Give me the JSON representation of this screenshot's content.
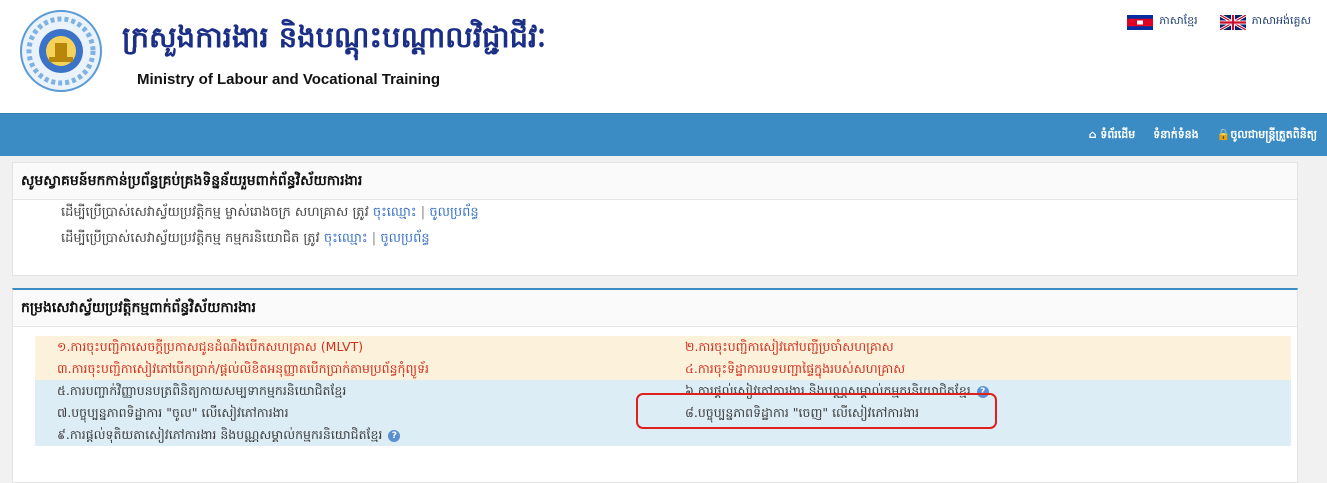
{
  "header": {
    "title_km": "ក្រសួងការងារ និងបណ្តុះបណ្តាលវិជ្ជាជីវៈ",
    "title_en": "Ministry of Labour and Vocational Training",
    "languages": [
      {
        "label": "ភាសាខ្មែរ",
        "icon": "cambodia-flag-icon"
      },
      {
        "label": "ភាសាអង់គ្លេស",
        "icon": "uk-flag-icon"
      }
    ]
  },
  "nav": {
    "home": "ទំព័រដើម",
    "contact": "ទំនាក់ទំនង",
    "login": "ចូលជាមន្រ្តីត្រួតពិនិត្យ",
    "home_icon": "home-icon",
    "lock_icon": "lock-icon"
  },
  "welcome": {
    "heading": "សូមស្វាគមន៍មកកាន់ប្រព័ន្ធគ្រប់គ្រងទិន្នន័យរួមពាក់ព័ន្ធវិស័យការងារ",
    "line1_text": "ដើម្បីប្រើប្រាស់សេវាស្វ័យប្រវត្តិកម្ម ម្ចាស់រោងចក្រ សហគ្រាស ត្រូវ",
    "line2_text": "ដើម្បីប្រើប្រាស់សេវាស្វ័យប្រវត្តិកម្ម កម្មករនិយោជិត ត្រូវ",
    "register": "ចុះឈ្មោះ",
    "separator": "|",
    "login": "ចូលប្រព័ន្ធ"
  },
  "services": {
    "heading": "កម្រងសេវាស្វ័យប្រវត្តិកម្មពាក់ព័ន្ធវិស័យការងារ",
    "items": [
      "១.ការចុះបញ្ជិកាសេចក្តីប្រកាសជូនដំណឹងបើកសហគ្រាស (MLVT)",
      "២.ការចុះបញ្ជិកាសៀវភៅបញ្ជីប្រចាំសហគ្រាស",
      "៣.ការចុះបញ្ជិកាសៀវភៅបើកប្រាក់/ផ្តល់លិខិតអនុញ្ញាតបើកប្រាក់តាមប្រព័ន្ធកុំព្យូទ័រ",
      "៤.ការចុះទិដ្ឋាការបទបញ្ជាផ្ទៃក្នុងរបស់សហគ្រាស",
      "៥.ការបញ្ចាក់វិញ្ញាបនបត្រពិនិត្យកាយសម្បទាកម្មករនិយោជិតខ្មែរ",
      "៦.ការផ្តល់សៀវភៅការងារ និងបណ្ណសម្គាល់កម្មករនិយោជិតខ្មែរ",
      "៧.បច្ចុប្បន្នភាពទិដ្ឋាការ \"ចូល\" លើសៀវភៅការងារ",
      "៨.បច្ចុប្បន្នភាពទិដ្ឋាការ \"ចេញ\" លើសៀវភៅការងារ",
      "៩.ការផ្តល់ទុតិយតាសៀវភៅការងារ និងបណ្ណសម្គាល់កម្មករនិយោជិតខ្មែរ"
    ],
    "help_mark": "?",
    "colors": {
      "warm": "#fcf1da",
      "cool": "#ddedf5",
      "red_text": "#d0311f",
      "highlight": "#e0201b"
    }
  }
}
